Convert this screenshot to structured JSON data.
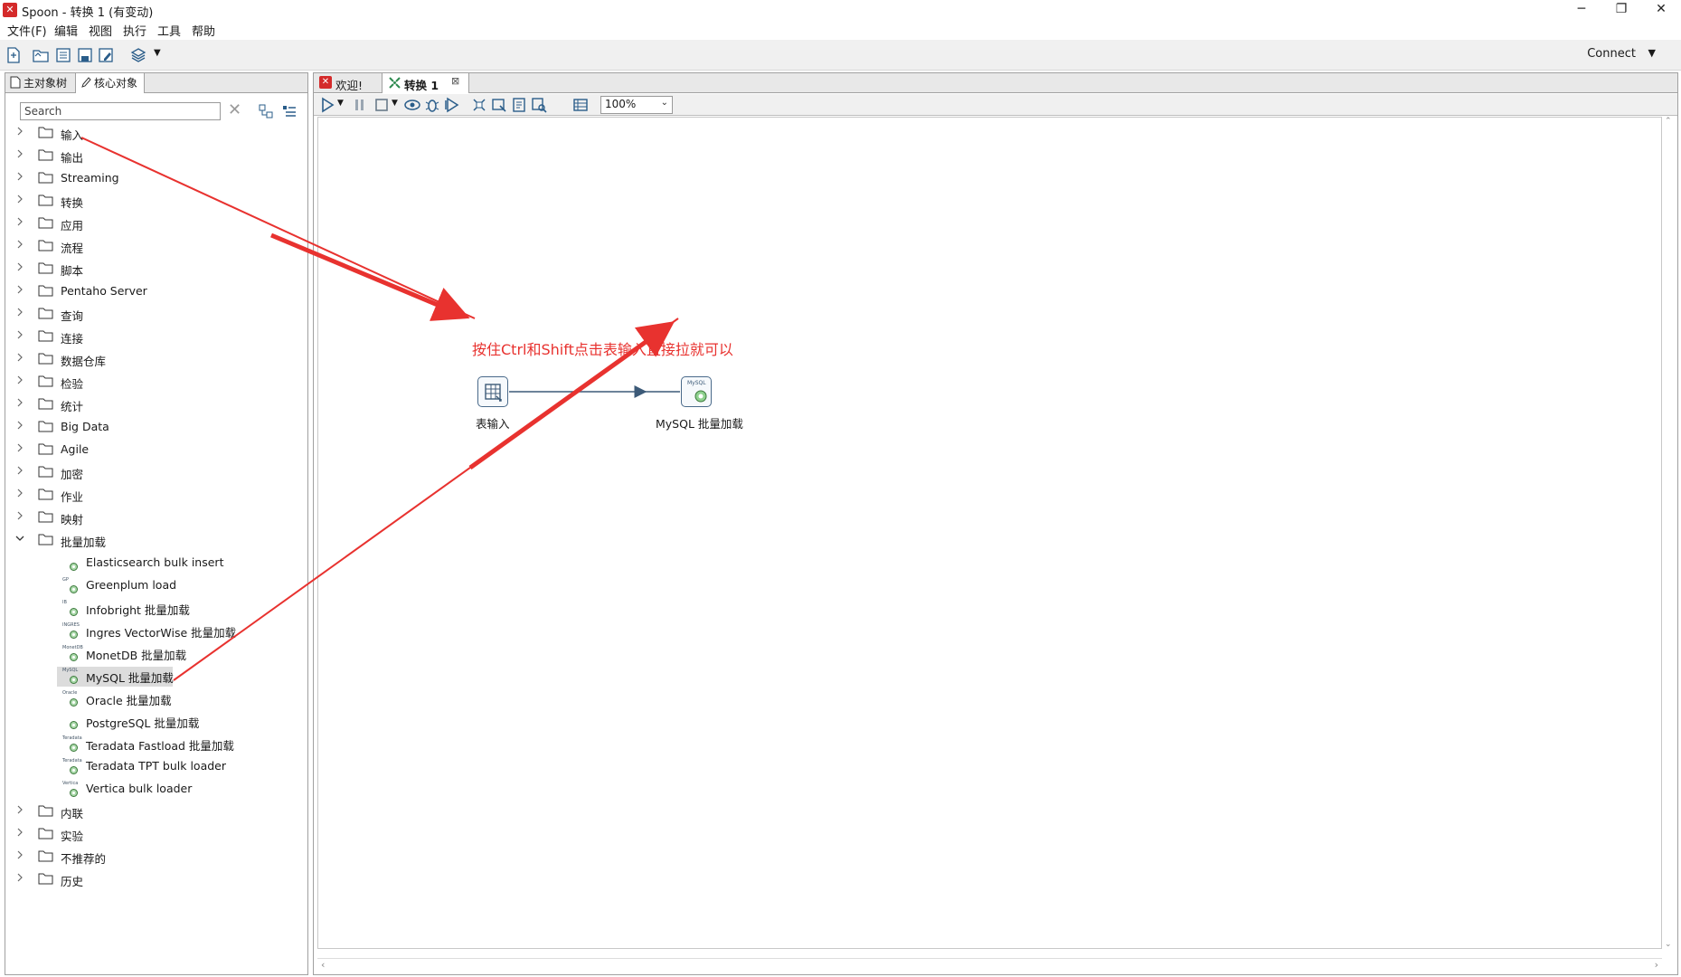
{
  "window": {
    "title": "Spoon - 转换 1 (有变动)",
    "minimize": "─",
    "restore": "❐",
    "close": "✕"
  },
  "menu": [
    "文件(F)",
    "编辑",
    "视图",
    "执行",
    "工具",
    "帮助"
  ],
  "toolbar": {
    "connect_label": "Connect"
  },
  "left_panel": {
    "tabs": [
      "主对象树",
      "核心对象"
    ],
    "search": {
      "placeholder": "Search",
      "value": ""
    },
    "tree": {
      "categories_top": [
        "输入",
        "输出",
        "Streaming",
        "转换",
        "应用",
        "流程",
        "脚本",
        "Pentaho Server",
        "查询",
        "连接",
        "数据仓库",
        "检验",
        "统计",
        "Big Data",
        "Agile",
        "加密",
        "作业",
        "映射"
      ],
      "expanded_category": "批量加载",
      "bulk_items": [
        "Elasticsearch bulk insert",
        "Greenplum load",
        "Infobright 批量加载",
        "Ingres VectorWise 批量加载",
        "MonetDB 批量加载",
        "MySQL 批量加载",
        "Oracle 批量加载",
        "PostgreSQL 批量加载",
        "Teradata Fastload 批量加载",
        "Teradata TPT bulk loader",
        "Vertica bulk loader"
      ],
      "bulk_icon_tags": [
        "",
        "GP",
        "IB",
        "INGRES",
        "MonetDB",
        "MySQL",
        "Oracle",
        "",
        "Teradata",
        "Teradata",
        "Vertica"
      ],
      "selected_item": "MySQL 批量加载",
      "categories_bottom": [
        "内联",
        "实验",
        "不推荐的",
        "历史"
      ]
    }
  },
  "editor": {
    "tabs": [
      {
        "label": "欢迎!",
        "closable": false
      },
      {
        "label": "转换 1",
        "closable": true,
        "active": true
      }
    ],
    "zoom": "100%",
    "annotation": "按住Ctrl和Shift点击表输入直接拉就可以",
    "steps": [
      {
        "label": "表输入",
        "icon_tag": ""
      },
      {
        "label": "MySQL 批量加载",
        "icon_tag": "MySQL"
      }
    ]
  },
  "colors": {
    "annotation_red": "#e8322f",
    "hop_blue": "#3c5a78",
    "logo_red": "#d42a2a"
  }
}
